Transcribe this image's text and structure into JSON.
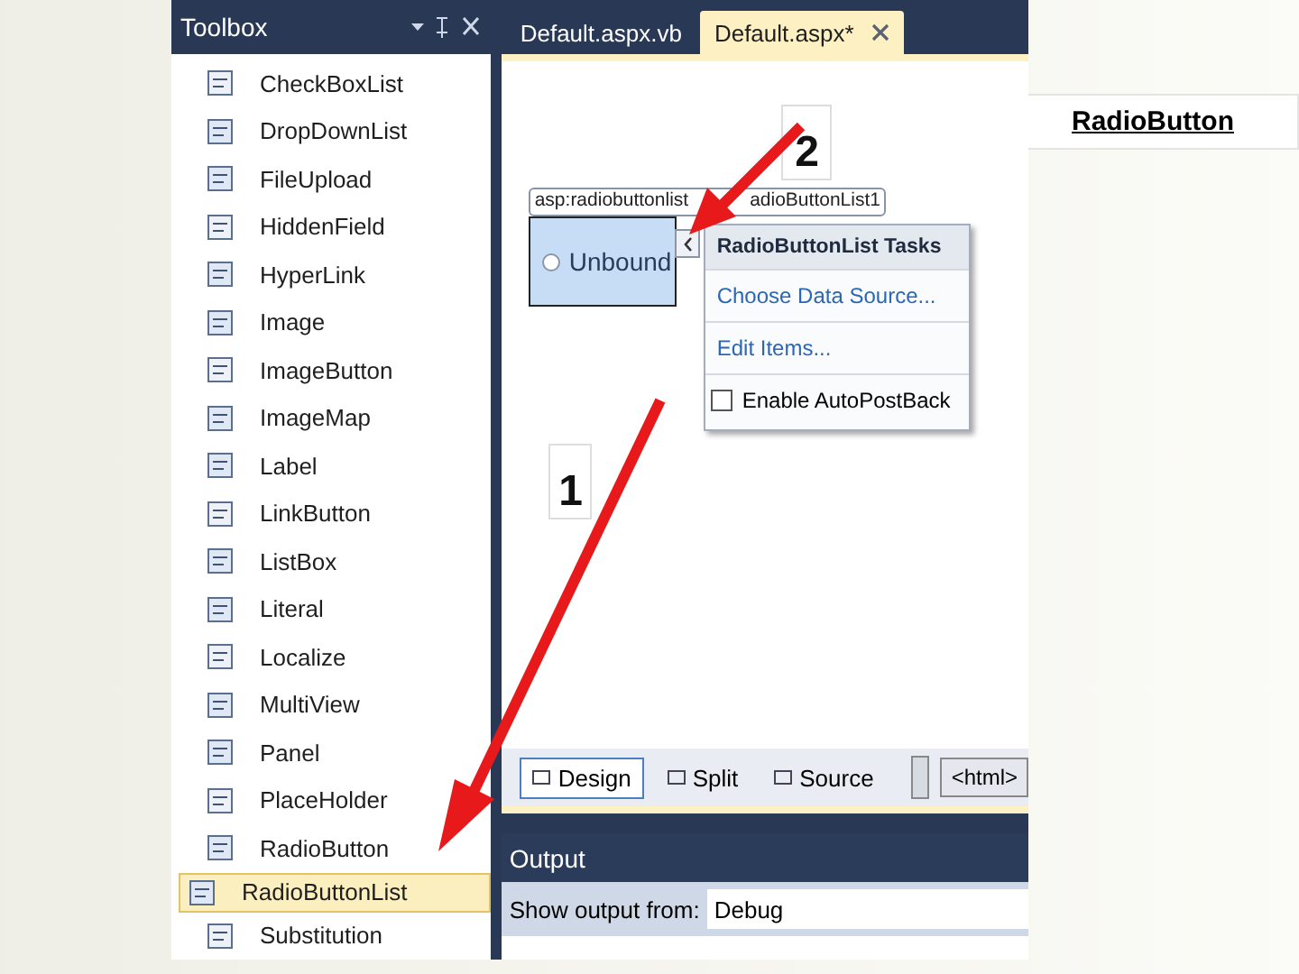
{
  "toolbox": {
    "title": "Toolbox",
    "items": [
      {
        "label": "CheckBoxList",
        "selected": false
      },
      {
        "label": "DropDownList",
        "selected": false
      },
      {
        "label": "FileUpload",
        "selected": false
      },
      {
        "label": "HiddenField",
        "selected": false
      },
      {
        "label": "HyperLink",
        "selected": false
      },
      {
        "label": "Image",
        "selected": false
      },
      {
        "label": "ImageButton",
        "selected": false
      },
      {
        "label": "ImageMap",
        "selected": false
      },
      {
        "label": "Label",
        "selected": false
      },
      {
        "label": "LinkButton",
        "selected": false
      },
      {
        "label": "ListBox",
        "selected": false
      },
      {
        "label": "Literal",
        "selected": false
      },
      {
        "label": "Localize",
        "selected": false
      },
      {
        "label": "MultiView",
        "selected": false
      },
      {
        "label": "Panel",
        "selected": false
      },
      {
        "label": "PlaceHolder",
        "selected": false
      },
      {
        "label": "RadioButton",
        "selected": false
      },
      {
        "label": "RadioButtonList",
        "selected": true
      },
      {
        "label": "Substitution",
        "selected": false
      }
    ]
  },
  "editor": {
    "tabs": [
      {
        "label": "Default.aspx.vb",
        "selected": false
      },
      {
        "label": "Default.aspx*",
        "selected": true
      }
    ],
    "design": {
      "tag_parts": [
        "asp:radiobuttonlist",
        "adioButtonList1"
      ],
      "radio_item": "Unbound",
      "tasks": {
        "title": "RadioButtonList Tasks",
        "links": [
          "Choose Data Source...",
          "Edit Items..."
        ],
        "checkbox": {
          "label": "Enable AutoPostBack",
          "checked": false
        }
      }
    },
    "view_tabs": [
      {
        "label": "Design",
        "selected": true
      },
      {
        "label": "Split",
        "selected": false
      },
      {
        "label": "Source",
        "selected": false
      }
    ],
    "breadcrumb": "<html>"
  },
  "output": {
    "title": "Output",
    "label": "Show output from:",
    "value": "Debug"
  },
  "annotations": {
    "step_numbers": [
      "1",
      "2"
    ],
    "side_label": "RadioButton"
  }
}
